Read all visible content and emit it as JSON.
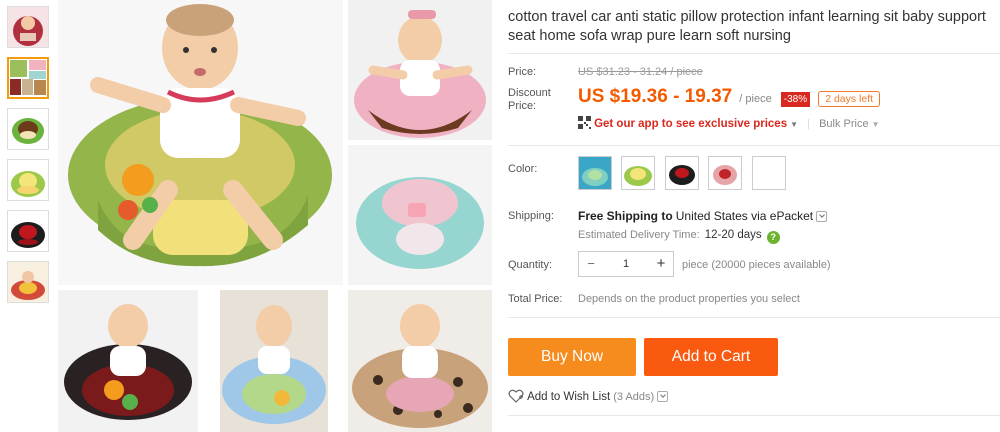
{
  "product": {
    "title": "cotton travel car anti static pillow protection infant learning sit baby support seat home sofa wrap pure learn soft nursing"
  },
  "price": {
    "label": "Price:",
    "original": "US $31.23 - 31.24 / piece",
    "discount_label": "Discount Price:",
    "discount_value": "US $19.36 - 19.37",
    "unit": "/ piece",
    "discount_percent": "-38%",
    "days_left": "2 days left",
    "app_link": "Get our app to see exclusive prices",
    "bulk_price": "Bulk Price"
  },
  "color": {
    "label": "Color:",
    "swatches": [
      "blue-green",
      "green",
      "black-red",
      "red-white",
      "white"
    ]
  },
  "shipping": {
    "label": "Shipping:",
    "free_text": "Free Shipping to",
    "country": "United States via ePacket",
    "delivery_label": "Estimated Delivery Time:",
    "delivery_value": "12-20 days",
    "help_icon": "?"
  },
  "quantity": {
    "label": "Quantity:",
    "value": "1",
    "minus": "−",
    "plus": "+",
    "availability": "piece (20000 pieces available)"
  },
  "total": {
    "label": "Total Price:",
    "value": "Depends on the product properties you select"
  },
  "actions": {
    "buy_now": "Buy Now",
    "add_to_cart": "Add to Cart",
    "wishlist": "Add to Wish List",
    "wishlist_count": "(3 Adds)"
  },
  "colors": {
    "accent_orange": "#f68b1e",
    "price_orange": "#f55a00",
    "discount_red": "#d9281f",
    "cart_orange": "#fa5a10"
  }
}
